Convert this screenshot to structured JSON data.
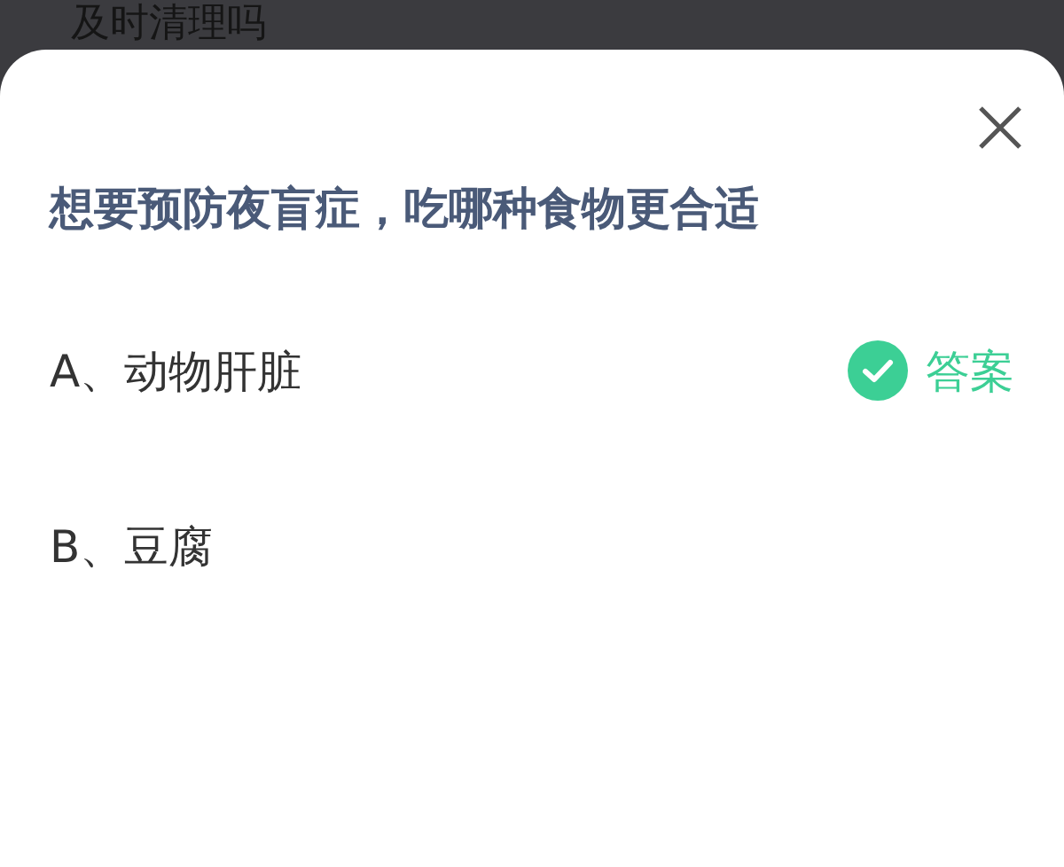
{
  "background_text": "及时清理吗",
  "question": "想要预防夜盲症，吃哪种食物更合适",
  "options": [
    {
      "label": "A、动物肝脏",
      "correct": true
    },
    {
      "label": "B、豆腐",
      "correct": false
    }
  ],
  "answer_badge": "答案"
}
